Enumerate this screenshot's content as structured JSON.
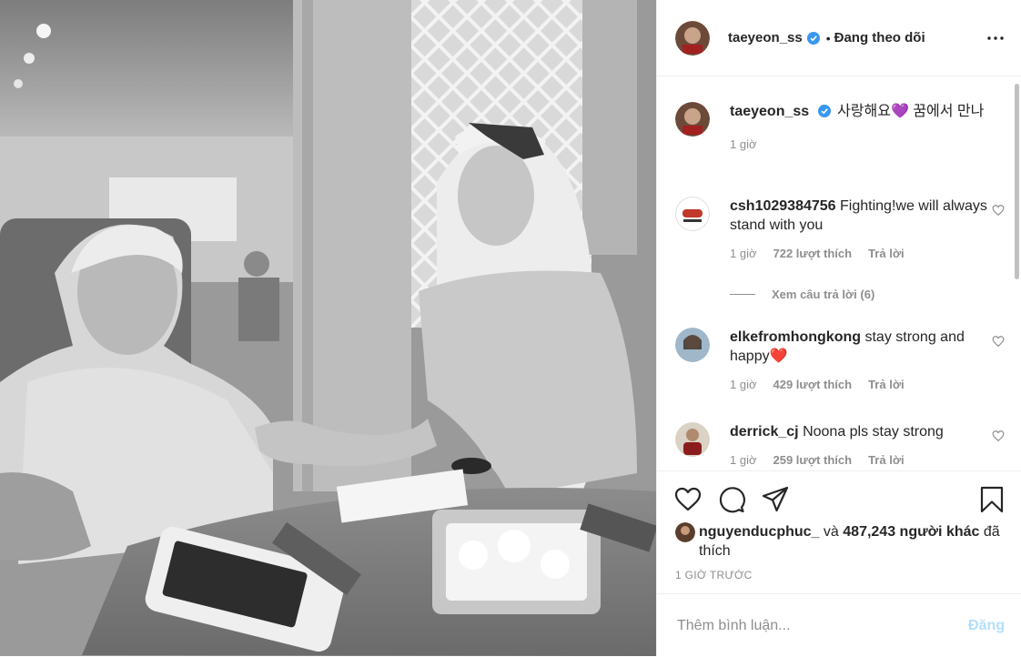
{
  "header": {
    "username": "taeyeon_ss",
    "separator": "•",
    "follow_label": "Đang theo dõi"
  },
  "caption": {
    "username": "taeyeon_ss",
    "text": "사랑해요💜 꿈에서 만나",
    "time": "1 giờ"
  },
  "comments": [
    {
      "username": "csh1029384756",
      "text": "Fighting!we will always stand with you",
      "time": "1 giờ",
      "likes": "722 lượt thích",
      "reply": "Trả lời"
    },
    {
      "username": "elkefromhongkong",
      "text": "stay strong and happy❤️",
      "time": "1 giờ",
      "likes": "429 lượt thích",
      "reply": "Trả lời"
    },
    {
      "username": "derrick_cj",
      "text": "Noona pls stay strong",
      "time": "1 giờ",
      "likes": "259 lượt thích",
      "reply": "Trả lời"
    }
  ],
  "view_replies": "Xem câu trả lời (6)",
  "likes_line": {
    "liker": "nguyenducphuc_",
    "connector": "và",
    "count": "487,243 người khác",
    "suffix": "đã thích"
  },
  "time_ago": "1 GIỜ TRƯỚC",
  "add_comment": {
    "placeholder": "Thêm bình luận...",
    "post_label": "Đăng"
  },
  "colors": {
    "verified": "#3897f0",
    "post_disabled": "#b2dffc",
    "muted": "#8e8e8e",
    "text": "#262626"
  },
  "icons": [
    "more-options-icon",
    "like-icon",
    "comment-icon",
    "share-icon",
    "save-icon",
    "heart-small-icon",
    "verified-badge-icon"
  ]
}
